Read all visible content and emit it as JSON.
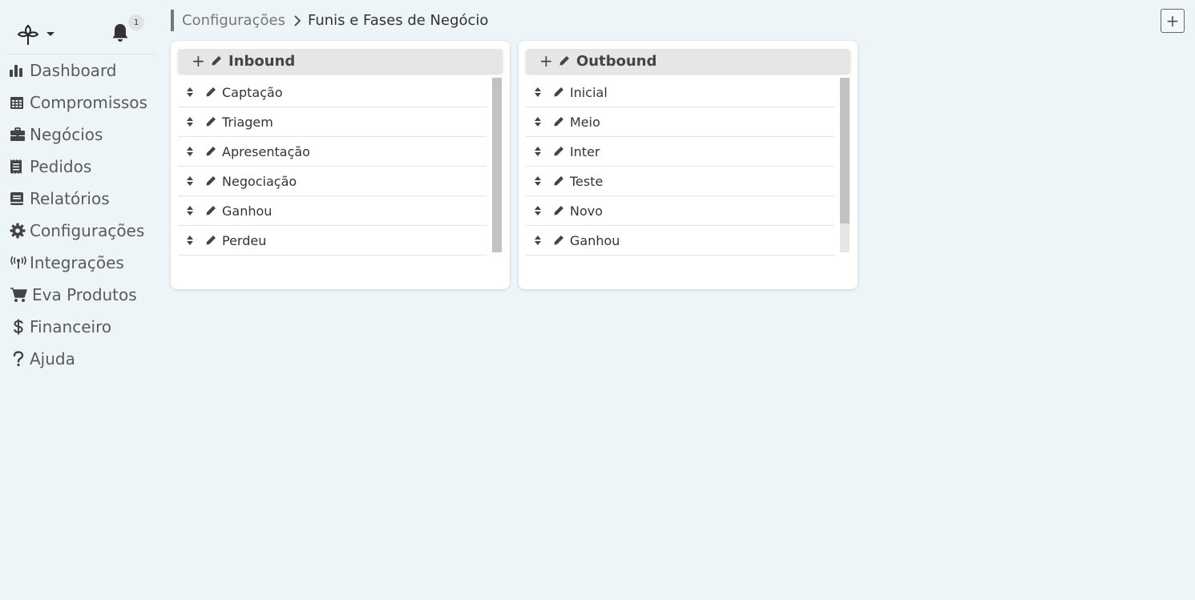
{
  "sidebar": {
    "notifications_count": "1",
    "items": [
      {
        "label": "Dashboard",
        "icon": "bar-chart-icon"
      },
      {
        "label": "Compromissos",
        "icon": "calendar-icon"
      },
      {
        "label": "Negócios",
        "icon": "briefcase-icon"
      },
      {
        "label": "Pedidos",
        "icon": "receipt-icon"
      },
      {
        "label": "Relatórios",
        "icon": "book-icon"
      },
      {
        "label": "Configurações",
        "icon": "gear-icon"
      },
      {
        "label": "Integrações",
        "icon": "broadcast-icon"
      },
      {
        "label": "Eva Produtos",
        "icon": "cart-icon"
      },
      {
        "label": "Financeiro",
        "icon": "dollar-icon"
      },
      {
        "label": "Ajuda",
        "icon": "question-icon"
      }
    ]
  },
  "breadcrumb": {
    "parent": "Configurações",
    "current": "Funis e Fases de Negócio"
  },
  "toolbar": {
    "add_label": "+"
  },
  "boards": [
    {
      "title": "Inbound",
      "add_label": "+",
      "stages": [
        "Captação",
        "Triagem",
        "Apresentação",
        "Negociação",
        "Ganhou",
        "Perdeu"
      ]
    },
    {
      "title": "Outbound",
      "add_label": "+",
      "stages": [
        "Inicial",
        "Meio",
        "Inter",
        "Teste",
        "Novo",
        "Ganhou"
      ]
    }
  ],
  "colors": {
    "background": "#eef5f9",
    "card": "#ffffff",
    "header": "#e6e6e6",
    "text": "#333333",
    "muted": "#777777"
  }
}
